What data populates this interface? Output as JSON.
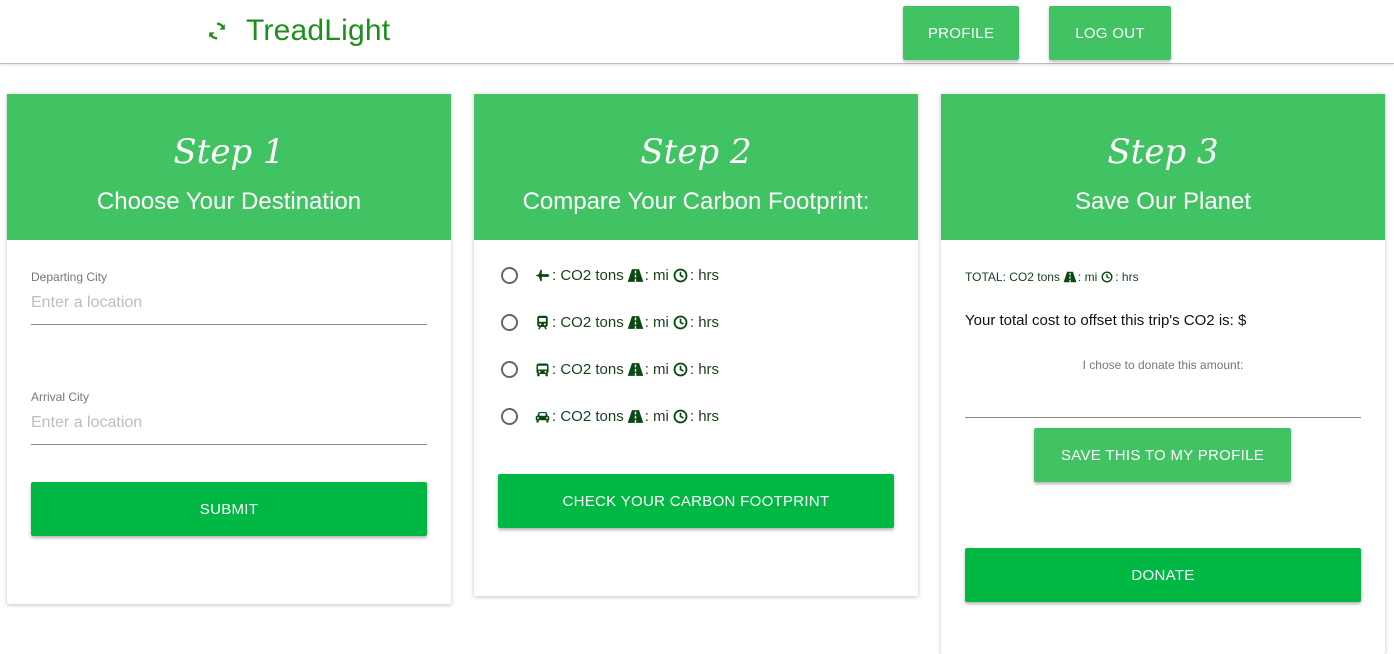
{
  "brand": {
    "name": "TreadLight",
    "icon": "refresh-icon",
    "color": "#1e8e1e"
  },
  "nav": {
    "profile_label": "PROFILE",
    "logout_label": "LOG OUT"
  },
  "step1": {
    "step_label": "Step 1",
    "title": "Choose Your Destination",
    "departing_label": "Departing City",
    "departing_placeholder": "Enter a location",
    "departing_value": "",
    "arrival_label": "Arrival City",
    "arrival_placeholder": "Enter a location",
    "arrival_value": "",
    "submit_label": "SUBMIT"
  },
  "step2": {
    "step_label": "Step 2",
    "title": "Compare Your Carbon Footprint:",
    "options": [
      {
        "icon": "plane-icon",
        "co2_text": ": CO2 tons",
        "distance_icon": "road-icon",
        "distance_text": ": mi",
        "time_icon": "clock-icon",
        "time_text": ": hrs"
      },
      {
        "icon": "train-icon",
        "co2_text": ": CO2 tons",
        "distance_icon": "road-icon",
        "distance_text": ": mi",
        "time_icon": "clock-icon",
        "time_text": ": hrs"
      },
      {
        "icon": "bus-icon",
        "co2_text": ": CO2 tons",
        "distance_icon": "road-icon",
        "distance_text": ": mi",
        "time_icon": "clock-icon",
        "time_text": ": hrs"
      },
      {
        "icon": "car-icon",
        "co2_text": ": CO2 tons",
        "distance_icon": "road-icon",
        "distance_text": ": mi",
        "time_icon": "clock-icon",
        "time_text": ": hrs"
      }
    ],
    "check_label": "CHECK YOUR CARBON FOOTPRINT"
  },
  "step3": {
    "step_label": "Step 3",
    "title": "Save Our Planet",
    "total_prefix": "TOTAL: CO2 tons",
    "total_distance_text": ": mi",
    "total_time_text": ": hrs",
    "offset_text": "Your total cost to offset this trip's CO2 is: $",
    "donate_label": "I chose to donate this amount:",
    "donate_value": "",
    "save_label": "SAVE THIS TO MY PROFILE",
    "donate_button_label": "DONATE"
  },
  "colors": {
    "header_green": "#41c363",
    "button_green": "#00b843",
    "icon_dark_green": "#0a4a12"
  }
}
